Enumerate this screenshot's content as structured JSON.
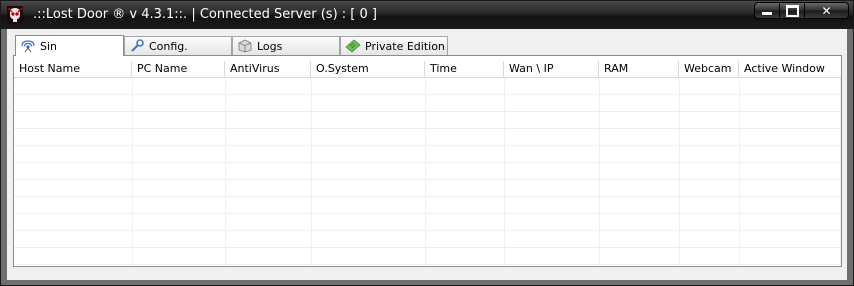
{
  "window": {
    "title": ".::Lost Door ® v 4.3.1::. | Connected Server (s) : [ 0 ]",
    "icon": "skull-app-icon",
    "controls": {
      "minimize": "minimize-icon",
      "maximize": "maximize-icon",
      "close": "close-icon"
    }
  },
  "tabs": [
    {
      "label": "Sin",
      "icon": "signal-icon",
      "active": true
    },
    {
      "label": "Config.",
      "icon": "wrench-icon",
      "active": false
    },
    {
      "label": "Logs",
      "icon": "box-icon",
      "active": false
    },
    {
      "label": "Private Edition",
      "icon": "ticket-icon",
      "active": false
    }
  ],
  "table": {
    "columns": [
      "Host Name",
      "PC Name",
      "AntiVirus",
      "O.System",
      "Time",
      "Wan \\ IP",
      "RAM",
      "Webcam",
      "Active Window"
    ],
    "rows": []
  },
  "colors": {
    "titlebar": "#1c1c1c",
    "title_text": "#ffffff",
    "client_bg": "#f0f0f0",
    "grid_bg": "#ffffff"
  }
}
